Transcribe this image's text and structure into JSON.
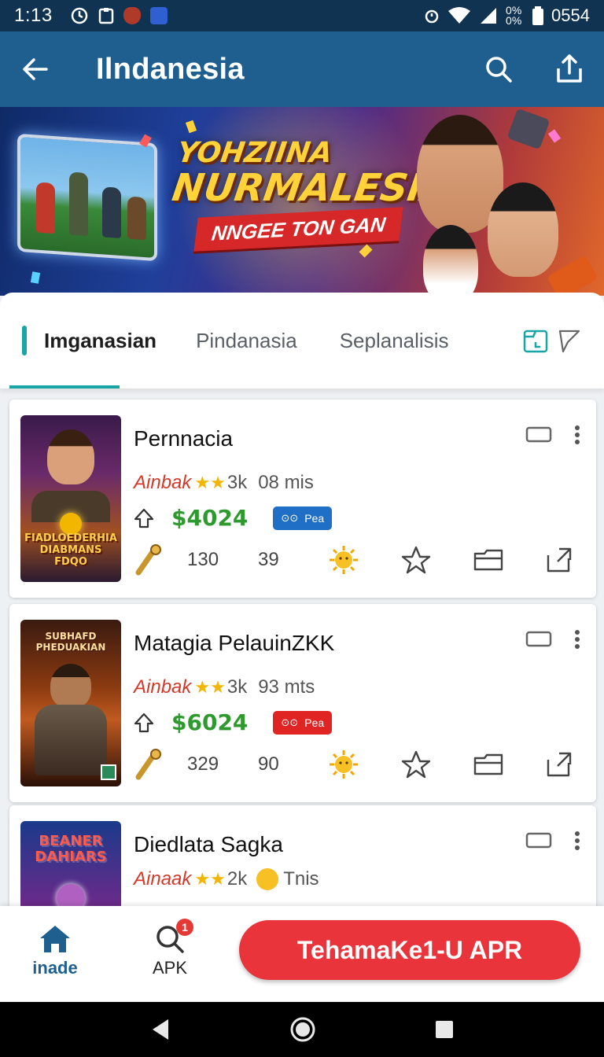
{
  "status_bar": {
    "time": "1:13",
    "battery_text": "0554",
    "signal_text": "0%\n0%"
  },
  "app_bar": {
    "title": "Ilndanesia",
    "icons": [
      "back-arrow-icon",
      "search-icon",
      "share-icon"
    ]
  },
  "banner": {
    "line1": "YOHZIINA",
    "line2": "NURMALESIA",
    "ribbon": "NNGEE TON GAN"
  },
  "tabs": {
    "items": [
      {
        "label": "Imganasian",
        "active": true
      },
      {
        "label": "Pindanasia",
        "active": false
      },
      {
        "label": "Seplanalisis",
        "active": false
      }
    ]
  },
  "apps": [
    {
      "title": "Pernnacia",
      "author": "Ainbak",
      "stars": "★★",
      "reviews": "3k",
      "extra": "08 mis",
      "price": "$4024",
      "badge_label": "Pea",
      "badge_color": "#1f6fc7",
      "stat1": "130",
      "stat2": "39",
      "thumb_text_top": "",
      "thumb_text_bottom": "FIADLOEDERHIA\nDIABMANS\nFDQO"
    },
    {
      "title": "Matagia PelauinZKK",
      "author": "Ainbak",
      "stars": "★★",
      "reviews": "3k",
      "extra": "93 mts",
      "price": "$6024",
      "badge_label": "Pea",
      "badge_color": "#e02424",
      "stat1": "329",
      "stat2": "90",
      "thumb_text_top": "SUBHAFD\nPHEDUAKIAN",
      "thumb_text_bottom": ""
    },
    {
      "title": "Diedlata Sagka",
      "author": "Ainaak",
      "stars": "★★",
      "reviews": "2k",
      "extra": "Tnis",
      "price": "",
      "badge_label": "",
      "badge_color": "#e8a020",
      "stat1": "",
      "stat2": "",
      "thumb_text_top": "BEANER\nDAHIARS",
      "thumb_text_bottom": ""
    }
  ],
  "bottom_nav": {
    "home_label": "inade",
    "apk_label": "APK",
    "apk_badge": "1",
    "cta_label": "TehamaKe1-U APR"
  },
  "colors": {
    "app_bar": "#1e5f8f",
    "accent_teal": "#17a5a5",
    "price_green": "#2e9a2e",
    "cta_red": "#e8343a"
  }
}
